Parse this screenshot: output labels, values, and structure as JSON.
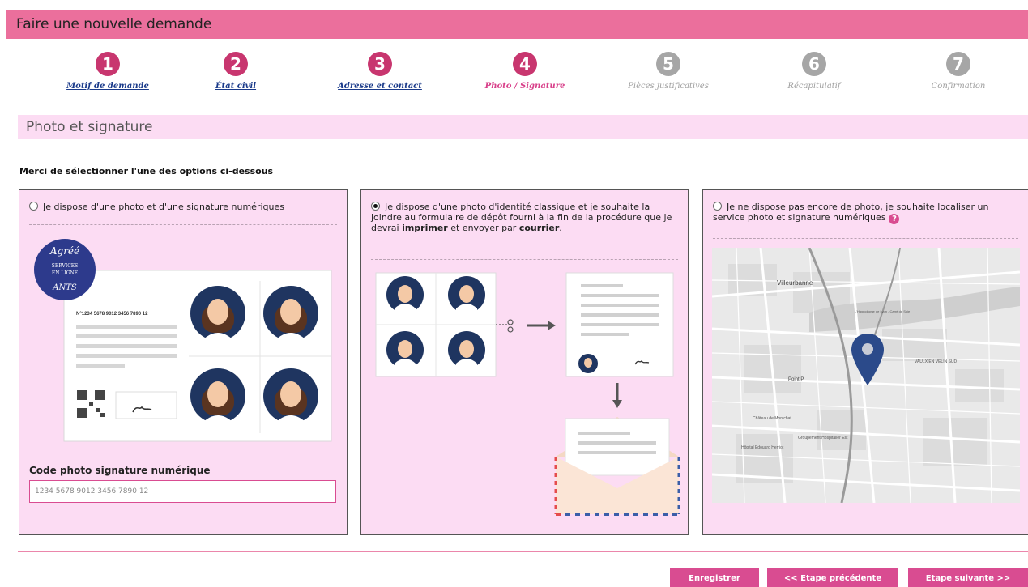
{
  "header": {
    "title": "Faire une nouvelle demande"
  },
  "steps": [
    {
      "num": "1",
      "label": "Motif de demande",
      "state": "done"
    },
    {
      "num": "2",
      "label": "État civil",
      "state": "done"
    },
    {
      "num": "3",
      "label": "Adresse et contact",
      "state": "done"
    },
    {
      "num": "4",
      "label": "Photo / Signature",
      "state": "active"
    },
    {
      "num": "5",
      "label": "Pièces justificatives",
      "state": "todo"
    },
    {
      "num": "6",
      "label": "Récapitulatif",
      "state": "todo"
    },
    {
      "num": "7",
      "label": "Confirmation",
      "state": "todo"
    }
  ],
  "section": {
    "title": "Photo et signature"
  },
  "instruction": "Merci de sélectionner l'une des options ci-dessous",
  "options": {
    "digital": {
      "text": "Je dispose d'une photo et d'une signature numériques",
      "selected": false,
      "badge": {
        "top": "Agréé",
        "mid1": "SERVICES",
        "mid2": "EN LIGNE",
        "bottom": "ANTS"
      },
      "card_number": "N°1234 5678 9012 3456 7890 12",
      "code_label": "Code photo signature numérique",
      "code_value": "1234 5678 9012 3456 7890 12"
    },
    "classic": {
      "text_start": "Je dispose d'une photo d'identité classique et je souhaite la joindre au formulaire de dépôt fourni à la fin de la procédure que je devrai ",
      "bold1": "imprimer",
      "text_mid": " et envoyer par ",
      "bold2": "courrier",
      "text_end": ".",
      "selected": true
    },
    "locate": {
      "text": "Je ne dispose pas encore de photo, je souhaite localiser un service photo et signature numériques",
      "help": "?",
      "selected": false,
      "map_labels": [
        "Villeurbanne",
        "VAULX EN VELIN SUD",
        "Point P",
        "Château de Montchat",
        "Hôpital Edouard Herriot",
        "Groupement Hospitalier Est",
        "L'Hippodrome de Lyon - Carré de Soie"
      ]
    }
  },
  "buttons": {
    "save": "Enregistrer",
    "prev": "<< Etape précédente",
    "next": "Etape suivante >>"
  },
  "colors": {
    "brand_pink": "#eb6f9c",
    "panel_pink": "#fcdcf3",
    "step_active": "#c8366f",
    "step_todo": "#a6a6a6",
    "map_pin": "#2b4a8a"
  }
}
